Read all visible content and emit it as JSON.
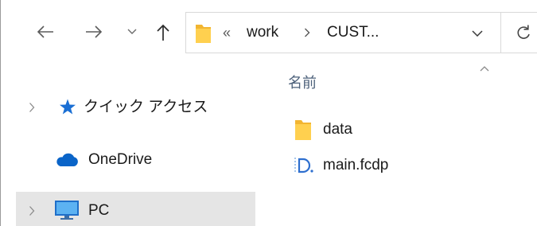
{
  "navigation": {
    "back_icon": "arrow-left-icon",
    "forward_icon": "arrow-right-icon",
    "recent_locations_icon": "chevron-down-icon",
    "up_icon": "arrow-up-icon"
  },
  "address_bar": {
    "location_icon": "folder-icon",
    "overflow": "«",
    "crumbs": [
      {
        "label": "work"
      },
      {
        "label": "CUST..."
      }
    ],
    "crumb_separator_icon": "chevron-right-icon",
    "history_dropdown_icon": "chevron-down-icon",
    "refresh_icon": "refresh-icon"
  },
  "nav_pane": {
    "items": [
      {
        "label": "クイック アクセス",
        "icon": "star-icon",
        "expandable": true,
        "highlighted": false
      },
      {
        "label": "OneDrive",
        "icon": "cloud-icon",
        "expandable": false,
        "highlighted": false
      },
      {
        "label": "PC",
        "icon": "computer-icon",
        "expandable": true,
        "highlighted": true
      }
    ]
  },
  "file_list": {
    "columns": [
      {
        "label": "名前",
        "sort_icon": "chevron-up-icon"
      }
    ],
    "items": [
      {
        "name": "data",
        "icon": "folder-icon"
      },
      {
        "name": "main.fcdp",
        "icon": "fcdp-file-icon"
      }
    ]
  },
  "colors": {
    "folder": "#ffd04f",
    "highlight": "#e5e5e5",
    "icon_blue": "#1a6fd4"
  }
}
